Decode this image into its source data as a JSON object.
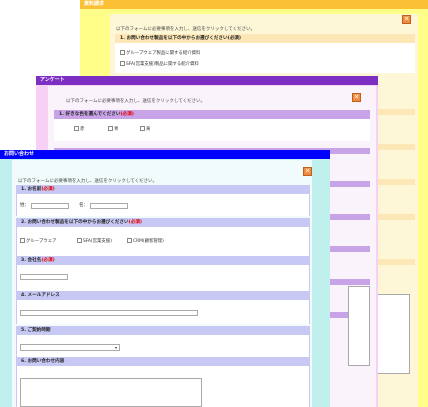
{
  "yellow": {
    "title": "資料請求",
    "intro": "以下のフォームに必要事項を入力し、送信をクリックしてください。",
    "q1": {
      "label": "1. お問い合わせ製品を以下の中からお選びください(必須)",
      "req": "(必須)"
    },
    "q1_options": [
      "グループウェア製品に関する紹介資料",
      "SFA(営業支援)製品に関する紹介資料"
    ]
  },
  "purple": {
    "title": "アンケート",
    "intro": "以下のフォームに必要事項を入力し、送信をクリックしてください。",
    "q1": {
      "label": "1. 好きな色を選んでください",
      "req": "(必須)"
    },
    "q1_options": [
      "赤",
      "青",
      "黄"
    ]
  },
  "blue": {
    "title": "お問い合わせ",
    "intro": "以下のフォームに必要事項を入力し、送信をクリックしてください。",
    "q1": {
      "label": "1. お名前",
      "req": "(必須)",
      "sei": "姓：",
      "mei": "名："
    },
    "q2": {
      "label": "2. お問い合わせ製品を以下の中からお選びください",
      "req": "(必須)",
      "options": [
        "グループウェア",
        "SFA(営業支援)",
        "CRM(顧客管理)"
      ]
    },
    "q3": {
      "label": "3. 会社名",
      "req": "(必須)"
    },
    "q4": {
      "label": "4. メールアドレス"
    },
    "q5": {
      "label": "5. ご契約時期",
      "select_value": "▾"
    },
    "q6": {
      "label": "6. お問い合わせ内容"
    }
  },
  "close_glyph": "✕",
  "colors": {
    "yellow_bg": "#fffe88",
    "purple_title": "#7e2fc3",
    "blue_title": "#0000ff",
    "close_orange": "#f08a3c"
  }
}
